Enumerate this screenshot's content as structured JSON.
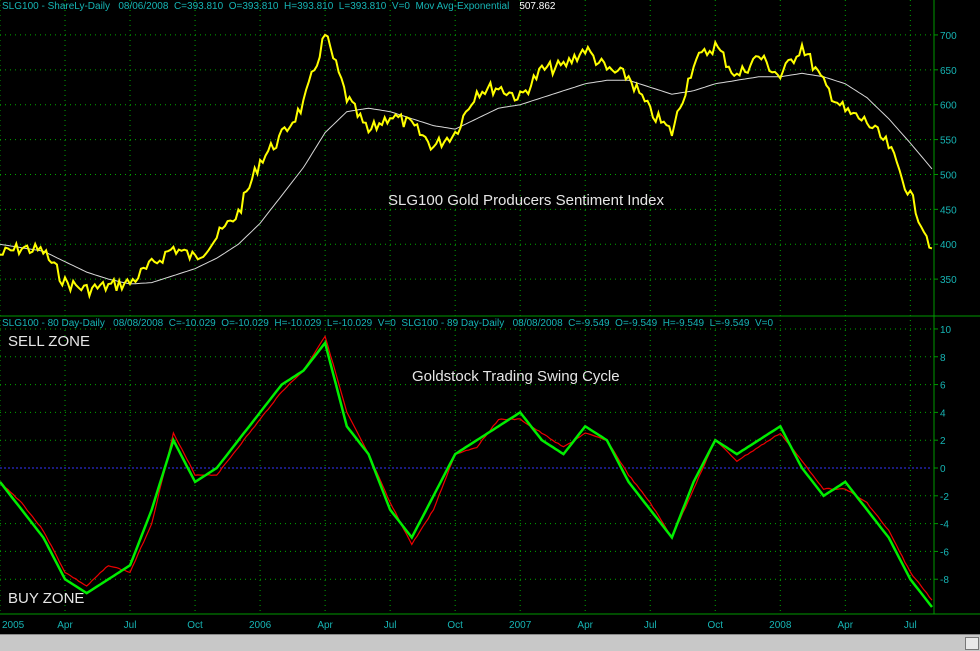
{
  "header_top": "SLG100 - ShareLy-Daily   08/06/2008  C=393.810  O=393.810  H=393.810  L=393.810  V=0  Mov Avg-Exponential",
  "header_top_value": "507.862",
  "header_bottom": "SLG100 - 80 Day-Daily   08/08/2008  C=-10.029  O=-10.029  H=-10.029  L=-10.029  V=0  SLG100 - 89 Day-Daily   08/08/2008  C=-9.549  O=-9.549  H=-9.549  L=-9.549  V=0",
  "sell_zone": "SELL ZONE",
  "buy_zone": "BUY ZONE",
  "colors": {
    "price": "#ffff00",
    "ma": "#d8d8d8",
    "osc_green": "#00ee00",
    "osc_red": "#ee0000",
    "zero_line": "#3333ff",
    "axis": "#009900",
    "grid": "#00aa00",
    "label": "#16b4b4"
  },
  "chart_data": [
    {
      "type": "line",
      "title": "SLG100 Gold Producers Sentiment Index",
      "ylim": [
        300,
        730
      ],
      "yticks": [
        350,
        400,
        450,
        500,
        550,
        600,
        650,
        700
      ],
      "series": [
        {
          "name": "SLG100",
          "x": [
            "2005-01",
            "2005-02",
            "2005-03",
            "2005-04",
            "2005-05",
            "2005-06",
            "2005-07",
            "2005-08",
            "2005-09",
            "2005-10",
            "2005-11",
            "2005-12",
            "2006-01",
            "2006-02",
            "2006-03",
            "2006-04",
            "2006-05",
            "2006-06",
            "2006-07",
            "2006-08",
            "2006-09",
            "2006-10",
            "2006-11",
            "2006-12",
            "2007-01",
            "2007-02",
            "2007-03",
            "2007-04",
            "2007-05",
            "2007-06",
            "2007-07",
            "2007-08",
            "2007-09",
            "2007-10",
            "2007-11",
            "2007-12",
            "2008-01",
            "2008-02",
            "2008-03",
            "2008-04",
            "2008-05",
            "2008-06",
            "2008-07",
            "2008-08"
          ],
          "values": [
            385,
            395,
            390,
            345,
            335,
            340,
            345,
            370,
            395,
            380,
            410,
            445,
            520,
            555,
            600,
            700,
            610,
            560,
            585,
            570,
            540,
            560,
            620,
            625,
            610,
            650,
            655,
            680,
            650,
            640,
            590,
            560,
            660,
            685,
            640,
            670,
            640,
            685,
            630,
            590,
            575,
            540,
            470,
            394
          ]
        },
        {
          "name": "Mov Avg-Exponential",
          "x": [
            "2005-01",
            "2005-02",
            "2005-03",
            "2005-04",
            "2005-05",
            "2005-06",
            "2005-07",
            "2005-08",
            "2005-09",
            "2005-10",
            "2005-11",
            "2005-12",
            "2006-01",
            "2006-02",
            "2006-03",
            "2006-04",
            "2006-05",
            "2006-06",
            "2006-07",
            "2006-08",
            "2006-09",
            "2006-10",
            "2006-11",
            "2006-12",
            "2007-01",
            "2007-02",
            "2007-03",
            "2007-04",
            "2007-05",
            "2007-06",
            "2007-07",
            "2007-08",
            "2007-09",
            "2007-10",
            "2007-11",
            "2007-12",
            "2008-01",
            "2008-02",
            "2008-03",
            "2008-04",
            "2008-05",
            "2008-06",
            "2008-07",
            "2008-08"
          ],
          "values": [
            400,
            395,
            390,
            375,
            360,
            350,
            343,
            345,
            355,
            365,
            380,
            400,
            430,
            470,
            510,
            560,
            590,
            595,
            590,
            580,
            570,
            565,
            580,
            595,
            600,
            610,
            620,
            630,
            635,
            635,
            625,
            615,
            620,
            630,
            635,
            640,
            640,
            645,
            640,
            630,
            610,
            580,
            545,
            508
          ]
        }
      ]
    },
    {
      "type": "line",
      "title": "Goldstock Trading Swing Cycle",
      "ylim": [
        -10.5,
        10.5
      ],
      "yticks": [
        10,
        8,
        6,
        4,
        2,
        0,
        -2,
        -4,
        -6,
        -8
      ],
      "xticks": [
        "2005",
        "Apr",
        "Jul",
        "Oct",
        "2006",
        "Apr",
        "Jul",
        "Oct",
        "2007",
        "Apr",
        "Jul",
        "Oct",
        "2008",
        "Apr",
        "Jul"
      ],
      "series": [
        {
          "name": "80 Day",
          "x": [
            "2005-01",
            "2005-02",
            "2005-03",
            "2005-04",
            "2005-05",
            "2005-06",
            "2005-07",
            "2005-08",
            "2005-09",
            "2005-10",
            "2005-11",
            "2005-12",
            "2006-01",
            "2006-02",
            "2006-03",
            "2006-04",
            "2006-05",
            "2006-06",
            "2006-07",
            "2006-08",
            "2006-09",
            "2006-10",
            "2006-11",
            "2006-12",
            "2007-01",
            "2007-02",
            "2007-03",
            "2007-04",
            "2007-05",
            "2007-06",
            "2007-07",
            "2007-08",
            "2007-09",
            "2007-10",
            "2007-11",
            "2007-12",
            "2008-01",
            "2008-02",
            "2008-03",
            "2008-04",
            "2008-05",
            "2008-06",
            "2008-07",
            "2008-08"
          ],
          "values": [
            -1,
            -3,
            -5,
            -8,
            -9,
            -8,
            -7,
            -3,
            2,
            -1,
            0,
            2,
            4,
            6,
            7,
            9,
            3,
            1,
            -3,
            -5,
            -2,
            1,
            2,
            3,
            4,
            2,
            1,
            3,
            2,
            -1,
            -3,
            -5,
            -1,
            2,
            1,
            2,
            3,
            0,
            -2,
            -1,
            -3,
            -5,
            -8,
            -10
          ]
        },
        {
          "name": "89 Day",
          "x": [
            "2005-01",
            "2005-02",
            "2005-03",
            "2005-04",
            "2005-05",
            "2005-06",
            "2005-07",
            "2005-08",
            "2005-09",
            "2005-10",
            "2005-11",
            "2005-12",
            "2006-01",
            "2006-02",
            "2006-03",
            "2006-04",
            "2006-05",
            "2006-06",
            "2006-07",
            "2006-08",
            "2006-09",
            "2006-10",
            "2006-11",
            "2006-12",
            "2007-01",
            "2007-02",
            "2007-03",
            "2007-04",
            "2007-05",
            "2007-06",
            "2007-07",
            "2007-08",
            "2007-09",
            "2007-10",
            "2007-11",
            "2007-12",
            "2008-01",
            "2008-02",
            "2008-03",
            "2008-04",
            "2008-05",
            "2008-06",
            "2008-07",
            "2008-08"
          ],
          "values": [
            -1,
            -2.5,
            -4.5,
            -7.5,
            -8.5,
            -7,
            -7.5,
            -4,
            2.5,
            -0.5,
            -0.5,
            1.5,
            3.5,
            5.5,
            7,
            9.5,
            4,
            1,
            -2.5,
            -5.5,
            -3,
            1,
            1.5,
            3.5,
            3.5,
            2.5,
            1.5,
            2.5,
            2,
            -0.5,
            -2.5,
            -5,
            -1.5,
            2,
            0.5,
            1.5,
            2.5,
            0.5,
            -1.5,
            -1.5,
            -2.5,
            -4.5,
            -7.5,
            -9.5
          ]
        }
      ]
    }
  ]
}
